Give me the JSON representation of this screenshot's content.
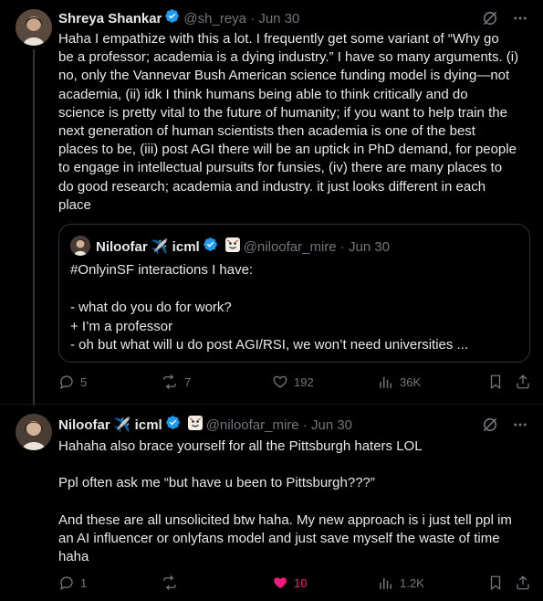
{
  "post1": {
    "name": "Shreya Shankar",
    "handle": "@sh_reya",
    "date": "Jun 30",
    "text": "Haha I empathize with this a lot. I frequently get some variant of “Why go\nbe a professor; academia is a dying industry.” I have so many arguments. (i)\nno, only the Vannevar Bush American science funding model is dying—not\nacademia, (ii) idk I think humans being able to think critically and do\nscience is pretty vital to the future of humanity; if you want to help train the\nnext generation of human scientists then academia is one of the best\nplaces to be, (iii) post AGI there will be an uptick in PhD demand, for people\nto engage in intellectual pursuits for funsies, (iv) there are many places to\ndo good research; academia and industry. it just looks different in each\nplace",
    "quote": {
      "name": "Niloofar ✈️ icml",
      "handle": "@niloofar_mire",
      "date": "Jun 30",
      "text": "#OnlyinSF interactions I have:\n\n- what do you do for work?\n+ I’m a professor\n- oh but what will u do post AGI/RSI, we won’t need universities ..."
    },
    "actions": {
      "replies": "5",
      "reposts": "7",
      "likes": "192",
      "views": "36K"
    }
  },
  "post2": {
    "name": "Niloofar ✈️ icml",
    "handle": "@niloofar_mire",
    "date": "Jun 30",
    "text": "Hahaha also brace yourself for all the Pittsburgh haters LOL\n\nPpl often ask me “but have u been to Pittsburgh???”\n\nAnd these are all unsolicited btw haha. My new approach is i just tell ppl im\nan AI influencer or onlyfans model and just save myself the waste of time\nhaha",
    "actions": {
      "replies": "1",
      "reposts": "",
      "likes": "10",
      "views": "1.2K"
    }
  },
  "icons": {
    "verified": "verified-badge-icon",
    "grok": "grok-icon",
    "more": "more-icon",
    "reply": "reply-icon",
    "repost": "repost-icon",
    "like": "like-icon",
    "views": "views-icon",
    "bookmark": "bookmark-icon",
    "share": "share-icon"
  },
  "colors": {
    "background": "#000000",
    "text": "#e7e9ea",
    "muted": "#71767b",
    "verified": "#1d9bf0",
    "like": "#f91880"
  }
}
